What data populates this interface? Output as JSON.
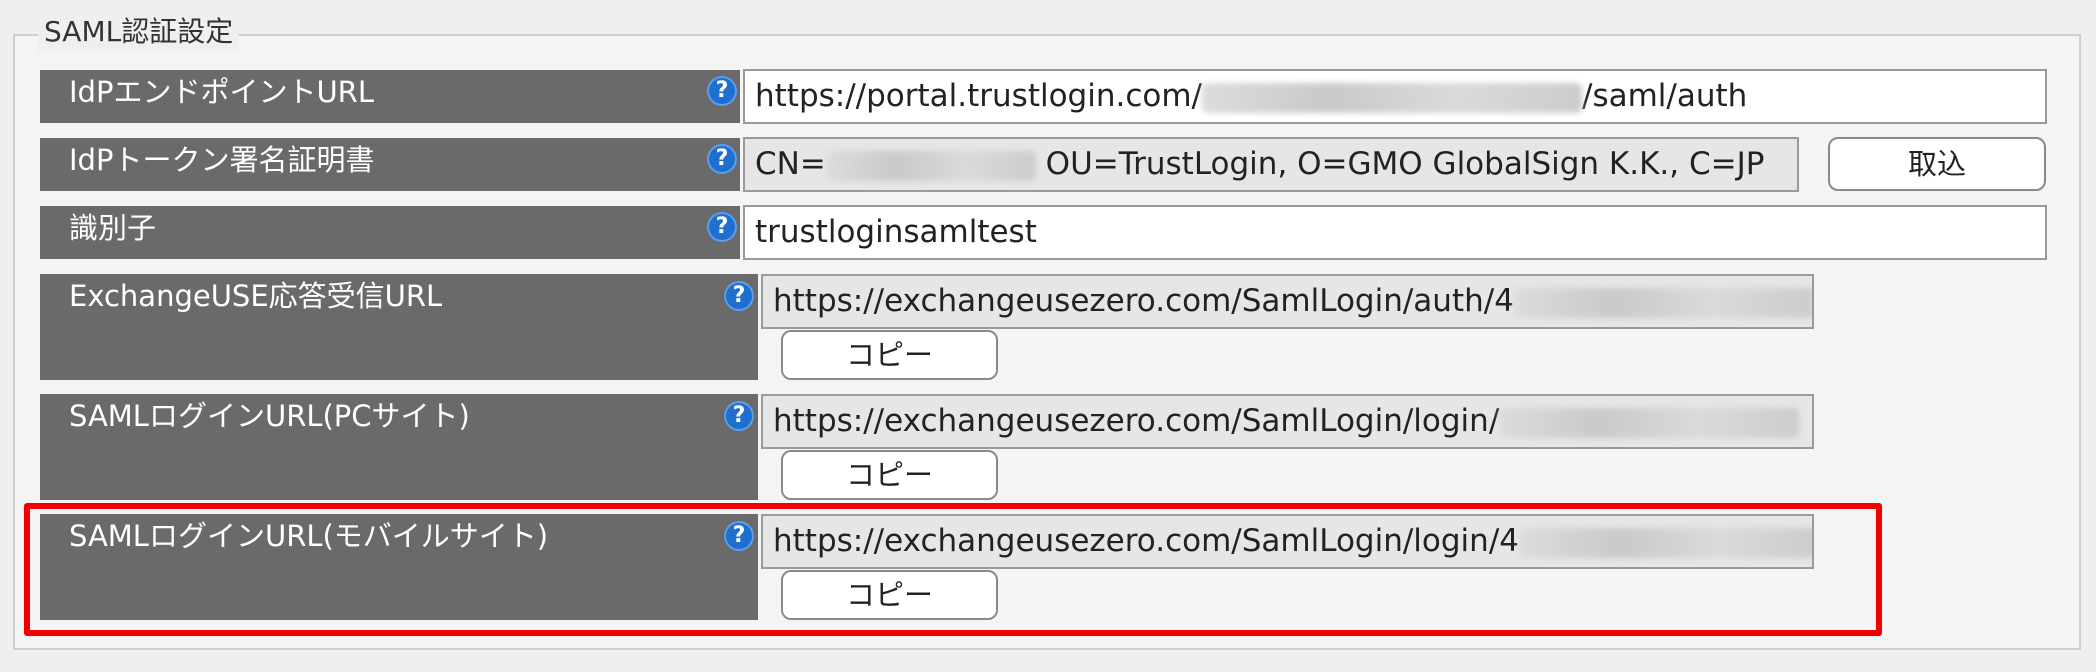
{
  "section_title": "SAML認証設定",
  "rows": [
    {
      "label": "IdPエンドポイントURL",
      "value_prefix": "https://portal.trustlogin.com/",
      "value_suffix": "/saml/auth"
    },
    {
      "label": "IdPトークン署名証明書",
      "value_prefix": "CN=",
      "value_suffix": "OU=TrustLogin, O=GMO GlobalSign K.K., C=JP",
      "button": "取込"
    },
    {
      "label": "識別子",
      "value": "trustloginsamltest"
    },
    {
      "label": "ExchangeUSE応答受信URL",
      "value_prefix": "https://exchangeusezero.com/SamlLogin/auth/",
      "value_suffix": "4",
      "button": "コピー"
    },
    {
      "label": "SAMLログインURL(PCサイト)",
      "value_prefix": "https://exchangeusezero.com/SamlLogin/login/",
      "button": "コピー"
    },
    {
      "label": "SAMLログインURL(モバイルサイト)",
      "value_prefix": "https://exchangeusezero.com/SamlLogin/login/",
      "value_suffix": "4",
      "button": "コピー"
    }
  ],
  "help_icon": "?",
  "colors": {
    "label_bg": "#6a6a6a",
    "help_blue": "#1f6fcf",
    "highlight": "#f00000"
  }
}
